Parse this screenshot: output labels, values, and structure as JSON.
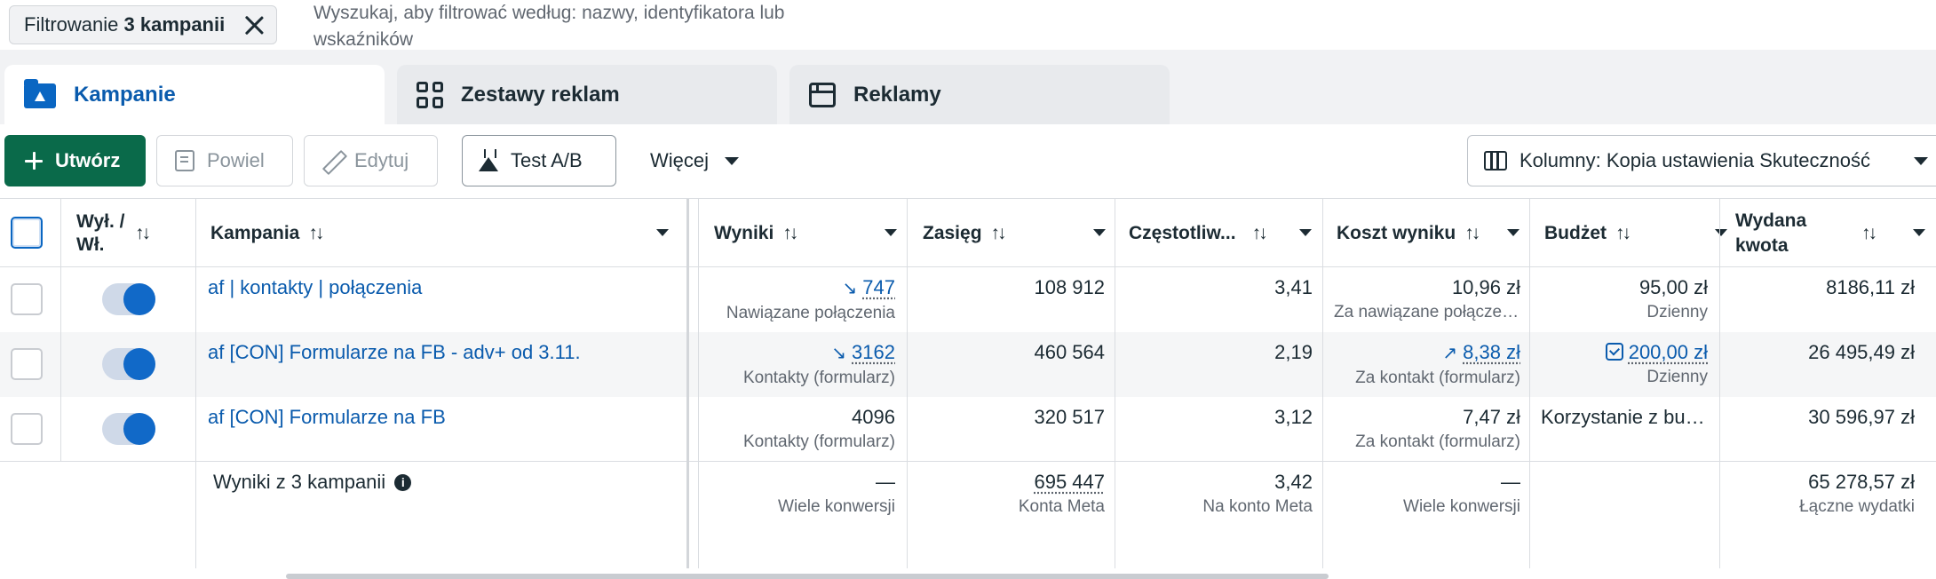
{
  "filter": {
    "chip_prefix": "Filtrowanie",
    "chip_bold": "3 kampanii",
    "search_placeholder": "Wyszukaj, aby filtrować według: nazwy, identyfikatora lub wskaźników"
  },
  "tabs": [
    {
      "label": "Kampanie",
      "icon": "campaign-folder-icon",
      "active": true
    },
    {
      "label": "Zestawy reklam",
      "icon": "ad-sets-grid-icon",
      "active": false
    },
    {
      "label": "Reklamy",
      "icon": "ad-window-icon",
      "active": false
    }
  ],
  "toolbar": {
    "create": "Utwórz",
    "duplicate": "Powiel",
    "edit": "Edytuj",
    "ab_test": "Test A/B",
    "more": "Więcej",
    "columns": "Kolumny: Kopia ustawienia Skuteczność"
  },
  "columns": {
    "toggle": "Wył. / Wł.",
    "campaign": "Kampania",
    "results": "Wyniki",
    "reach": "Zasięg",
    "frequency": "Częstotliw...",
    "cost_per_result": "Koszt wyniku",
    "budget": "Budżet",
    "amount_spent": "Wydana kwota"
  },
  "rows": [
    {
      "name": "af | kontakty | połączenia",
      "results": "747",
      "results_sub": "Nawiązane połączenia",
      "results_trend": "down",
      "reach": "108 912",
      "frequency": "3,41",
      "cost": "10,96 zł",
      "cost_sub": "Za nawiązane połączenie",
      "budget": "95,00 zł",
      "budget_sub": "Dzienny",
      "spent": "8186,11 zł"
    },
    {
      "name": "af [CON] Formularze na FB - adv+ od 3.11.",
      "results": "3162",
      "results_sub": "Kontakty (formularz)",
      "results_trend": "down",
      "reach": "460 564",
      "frequency": "2,19",
      "cost": "8,38 zł",
      "cost_sub": "Za kontakt (formularz)",
      "cost_trend": "up",
      "budget": "200,00 zł",
      "budget_sub": "Dzienny",
      "spent": "26 495,49 zł"
    },
    {
      "name": "af [CON] Formularze na FB",
      "results": "4096",
      "results_sub": "Kontakty (formularz)",
      "reach": "320 517",
      "frequency": "3,12",
      "cost": "7,47 zł",
      "cost_sub": "Za kontakt (formularz)",
      "budget": "Korzystanie z budżetu zestawu reklam",
      "spent": "30 596,97 zł"
    }
  ],
  "totals": {
    "label": "Wyniki z 3 kampanii",
    "results": "—",
    "results_sub": "Wiele konwersji",
    "reach": "695 447",
    "reach_sub": "Konta Meta",
    "frequency": "3,42",
    "frequency_sub": "Na konto Meta",
    "cost": "—",
    "cost_sub": "Wiele konwersji",
    "spent": "65 278,57 zł",
    "spent_sub": "Łączne wydatki"
  },
  "colors": {
    "primary_green": "#0a6a4a",
    "link_blue": "#0a5bad",
    "toggle_on": "#1169c8"
  }
}
